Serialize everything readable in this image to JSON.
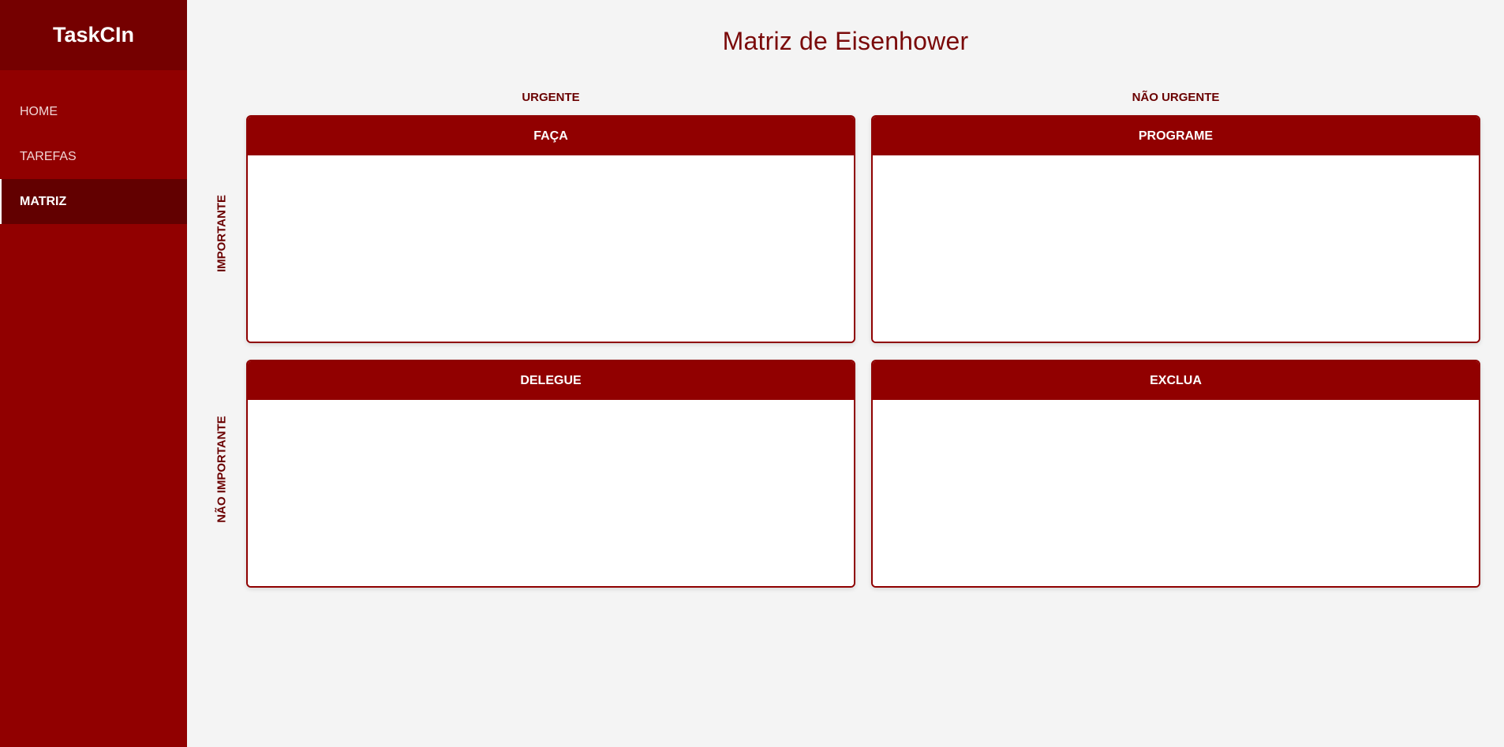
{
  "app": {
    "name": "TaskCIn"
  },
  "sidebar": {
    "items": [
      {
        "label": "HOME"
      },
      {
        "label": "TAREFAS"
      },
      {
        "label": "MATRIZ"
      }
    ]
  },
  "main": {
    "title": "Matriz de Eisenhower",
    "columns": {
      "urgent": "URGENTE",
      "not_urgent": "NÃO URGENTE"
    },
    "rows": {
      "important": "IMPORTANTE",
      "not_important": "NÃO IMPORTANTE"
    },
    "quadrants": [
      {
        "title": "FAÇA"
      },
      {
        "title": "PROGRAME"
      },
      {
        "title": "DELEGUE"
      },
      {
        "title": "EXCLUA"
      }
    ]
  },
  "colors": {
    "sidebar": "#910000",
    "brand_bar": "#750000",
    "active_item": "#620000",
    "accent_text": "#7a0a0a",
    "background": "#f4f4f4"
  }
}
